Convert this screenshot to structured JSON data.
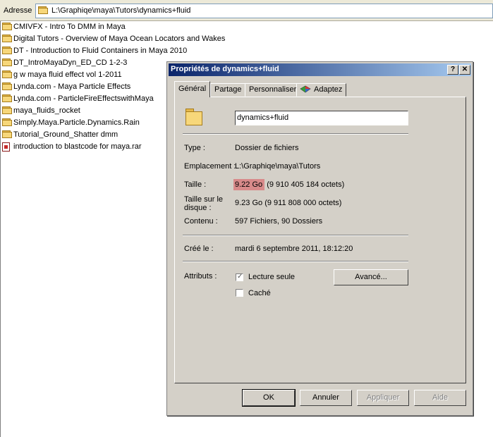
{
  "address_bar": {
    "label": "Adresse",
    "path": "L:\\Graphiqe\\maya\\Tutors\\dynamics+fluid"
  },
  "files": [
    {
      "name": "CMIVFX - Intro To DMM in Maya",
      "icon": "folder-icon"
    },
    {
      "name": "Digital Tutors - Overview of Maya Ocean Locators and Wakes",
      "icon": "folder-icon"
    },
    {
      "name": "DT - Introduction to Fluid Containers in Maya 2010",
      "icon": "folder-icon"
    },
    {
      "name": "DT_IntroMayaDyn_ED_CD 1-2-3",
      "icon": "folder-icon"
    },
    {
      "name": "g w maya fluid effect vol 1-2011",
      "icon": "folder-icon"
    },
    {
      "name": "Lynda.com - Maya Particle Effects",
      "icon": "folder-icon"
    },
    {
      "name": "Lynda.com - ParticleFireEffectswithMaya",
      "icon": "folder-icon"
    },
    {
      "name": "maya_fluids_rocket",
      "icon": "folder-icon"
    },
    {
      "name": "Simply.Maya.Particle.Dynamics.Rain",
      "icon": "folder-icon"
    },
    {
      "name": "Tutorial_Ground_Shatter dmm",
      "icon": "folder-icon"
    },
    {
      "name": "introduction to blastcode for maya.rar",
      "icon": "rar-archive-icon"
    }
  ],
  "dialog": {
    "title": "Propriétés de dynamics+fluid",
    "help_button": "?",
    "close_button": "✕",
    "tabs": [
      "Général",
      "Partage",
      "Personnaliser",
      "Adaptez"
    ],
    "folder_name": "dynamics+fluid",
    "type_label": "Type :",
    "type_value": "Dossier de fichiers",
    "location_label": "Emplacement :",
    "location_value": "L:\\Graphiqe\\maya\\Tutors",
    "size_label": "Taille :",
    "size_value_highlight": "9.22 Go",
    "size_value_rest": " (9 910 405 184 octets)",
    "disk_size_label_line1": "Taille sur le",
    "disk_size_label_line2": "disque :",
    "disk_size_value": "9.23 Go (9 911 808 000 octets)",
    "contents_label": "Contenu :",
    "contents_value": "597 Fichiers, 90 Dossiers",
    "created_label": "Créé le :",
    "created_value": "mardi 6 septembre 2011, 18:12:20",
    "attributes_label": "Attributs :",
    "readonly_label": "Lecture seule",
    "readonly_checked": true,
    "hidden_label": "Caché",
    "hidden_checked": false,
    "advanced_button": "Avancé...",
    "ok_button": "OK",
    "cancel_button": "Annuler",
    "apply_button": "Appliquer",
    "help_text_button": "Aide"
  },
  "colors": {
    "titlebar_start": "#0a246a",
    "titlebar_end": "#a6caf0",
    "highlight": "#d88a8a",
    "dialog_bg": "#d4d0c8"
  }
}
